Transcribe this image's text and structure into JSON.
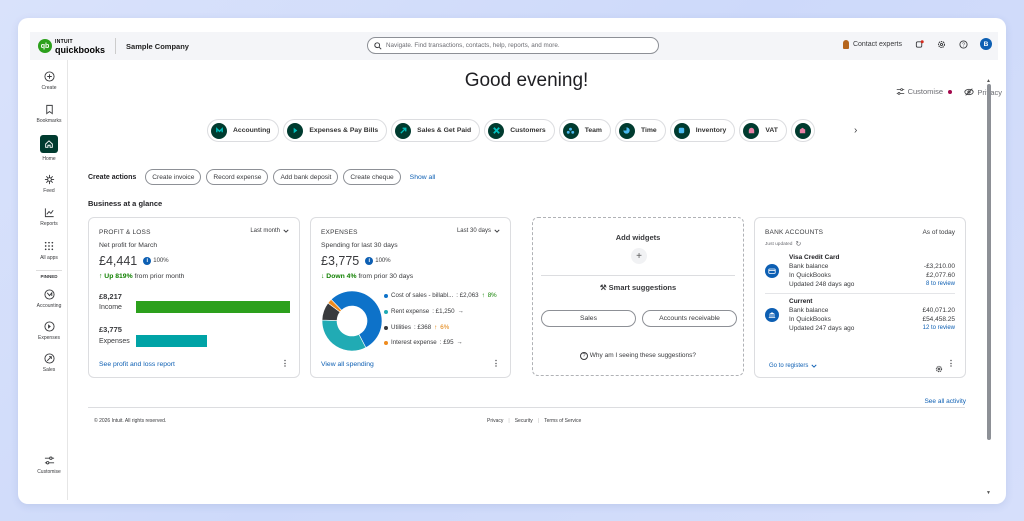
{
  "topbar": {
    "logo_line1": "INTUIT",
    "logo_line2": "quickbooks",
    "company": "Sample Company",
    "search_placeholder": "Navigate. Find transactions, contacts, help, reports, and more.",
    "contact_experts": "Contact experts",
    "user_initial": "B"
  },
  "sidebar": {
    "items": [
      {
        "label": "Create",
        "icon": "plus-circle-icon"
      },
      {
        "label": "Bookmarks",
        "icon": "bookmark-icon"
      },
      {
        "label": "Home",
        "icon": "home-icon"
      },
      {
        "label": "Feed",
        "icon": "sparkle-icon"
      },
      {
        "label": "Reports",
        "icon": "chart-icon"
      },
      {
        "label": "All apps",
        "icon": "grid-icon"
      }
    ],
    "pinned_label": "PINNED",
    "pinned": [
      {
        "label": "Accounting",
        "icon": "accounting-icon"
      },
      {
        "label": "Expenses",
        "icon": "expenses-icon"
      },
      {
        "label": "Sales",
        "icon": "sales-icon"
      }
    ],
    "customise": "Customise"
  },
  "header": {
    "greeting": "Good evening!",
    "customise": "Customise",
    "privacy": "Privacy"
  },
  "chips": [
    {
      "label": "Accounting",
      "color": "#00a3a6"
    },
    {
      "label": "Expenses & Pay Bills",
      "color": "#00a3a6"
    },
    {
      "label": "Sales & Get Paid",
      "color": "#00a3a6"
    },
    {
      "label": "Customers",
      "color": "#00a3a6"
    },
    {
      "label": "Team",
      "color": "#2ca4e0"
    },
    {
      "label": "Time",
      "color": "#2ca4e0"
    },
    {
      "label": "Inventory",
      "color": "#2ca4e0"
    },
    {
      "label": "VAT",
      "color": "#e77fa5"
    }
  ],
  "create_actions": {
    "title": "Create actions",
    "buttons": [
      "Create invoice",
      "Record expense",
      "Add bank deposit",
      "Create cheque"
    ],
    "show_all": "Show all"
  },
  "glance_title": "Business at a glance",
  "pl": {
    "title": "PROFIT & LOSS",
    "period": "Last month",
    "sub": "Net profit for March",
    "net": "£4,441",
    "pct": "100%",
    "trend_bold": "Up 819%",
    "trend_rest": " from prior month",
    "income_value": "£8,217",
    "income_label": "Income",
    "expenses_value": "£3,775",
    "expenses_label": "Expenses",
    "link": "See profit and loss report",
    "income_color": "#2ca01c",
    "expenses_color": "#00a3a6"
  },
  "expenses": {
    "title": "EXPENSES",
    "period": "Last 30 days",
    "sub": "Spending for last 30 days",
    "total": "£3,775",
    "pct": "100%",
    "trend_bold": "Down 4%",
    "trend_rest": " from prior 30 days",
    "legend": [
      {
        "label": "Cost of sales - billabl...",
        "amount": "£2,063",
        "change": "8%",
        "dir": "up",
        "color": "#0d72c9"
      },
      {
        "label": "Rent expense",
        "amount": "£1,250",
        "change": "",
        "dir": "flat",
        "color": "#21abb4"
      },
      {
        "label": "Utilities",
        "amount": "£368",
        "change": "6%",
        "dir": "up-orange",
        "color": "#393a3d"
      },
      {
        "label": "Interest expense",
        "amount": "£95",
        "change": "",
        "dir": "flat",
        "color": "#ee8b1e"
      }
    ],
    "link": "View all spending"
  },
  "widgets": {
    "title": "Add widgets",
    "smart": "Smart suggestions",
    "pill_sales": "Sales",
    "pill_ar": "Accounts receivable",
    "why": "Why am I seeing these suggestions?"
  },
  "bank": {
    "title": "BANK ACCOUNTS",
    "as_of": "As of today",
    "updated": "Just updated",
    "accounts": [
      {
        "name": "Visa Credit Card",
        "bank_label": "Bank balance",
        "bank_value": "-£3,210.00",
        "qb_label": "In QuickBooks",
        "qb_value": "£2,077.60",
        "updated": "Updated 248 days ago",
        "review": "8 to review"
      },
      {
        "name": "Current",
        "bank_label": "Bank balance",
        "bank_value": "£40,071.20",
        "qb_label": "In QuickBooks",
        "qb_value": "£54,458.25",
        "updated": "Updated 247 days ago",
        "review": "12 to review"
      }
    ],
    "go_to": "Go to registers"
  },
  "see_all_activity": "See all activity",
  "footer": {
    "copyright": "© 2026 Intuit. All rights reserved.",
    "links": [
      "Privacy",
      "Security",
      "Terms of Service"
    ]
  },
  "chart_data": {
    "type": "pie",
    "categories": [
      "Cost of sales - billable",
      "Rent expense",
      "Utilities",
      "Interest expense"
    ],
    "values": [
      2063,
      1250,
      368,
      95
    ],
    "colors": [
      "#0d72c9",
      "#21abb4",
      "#393a3d",
      "#ee8b1e"
    ],
    "title": ""
  }
}
